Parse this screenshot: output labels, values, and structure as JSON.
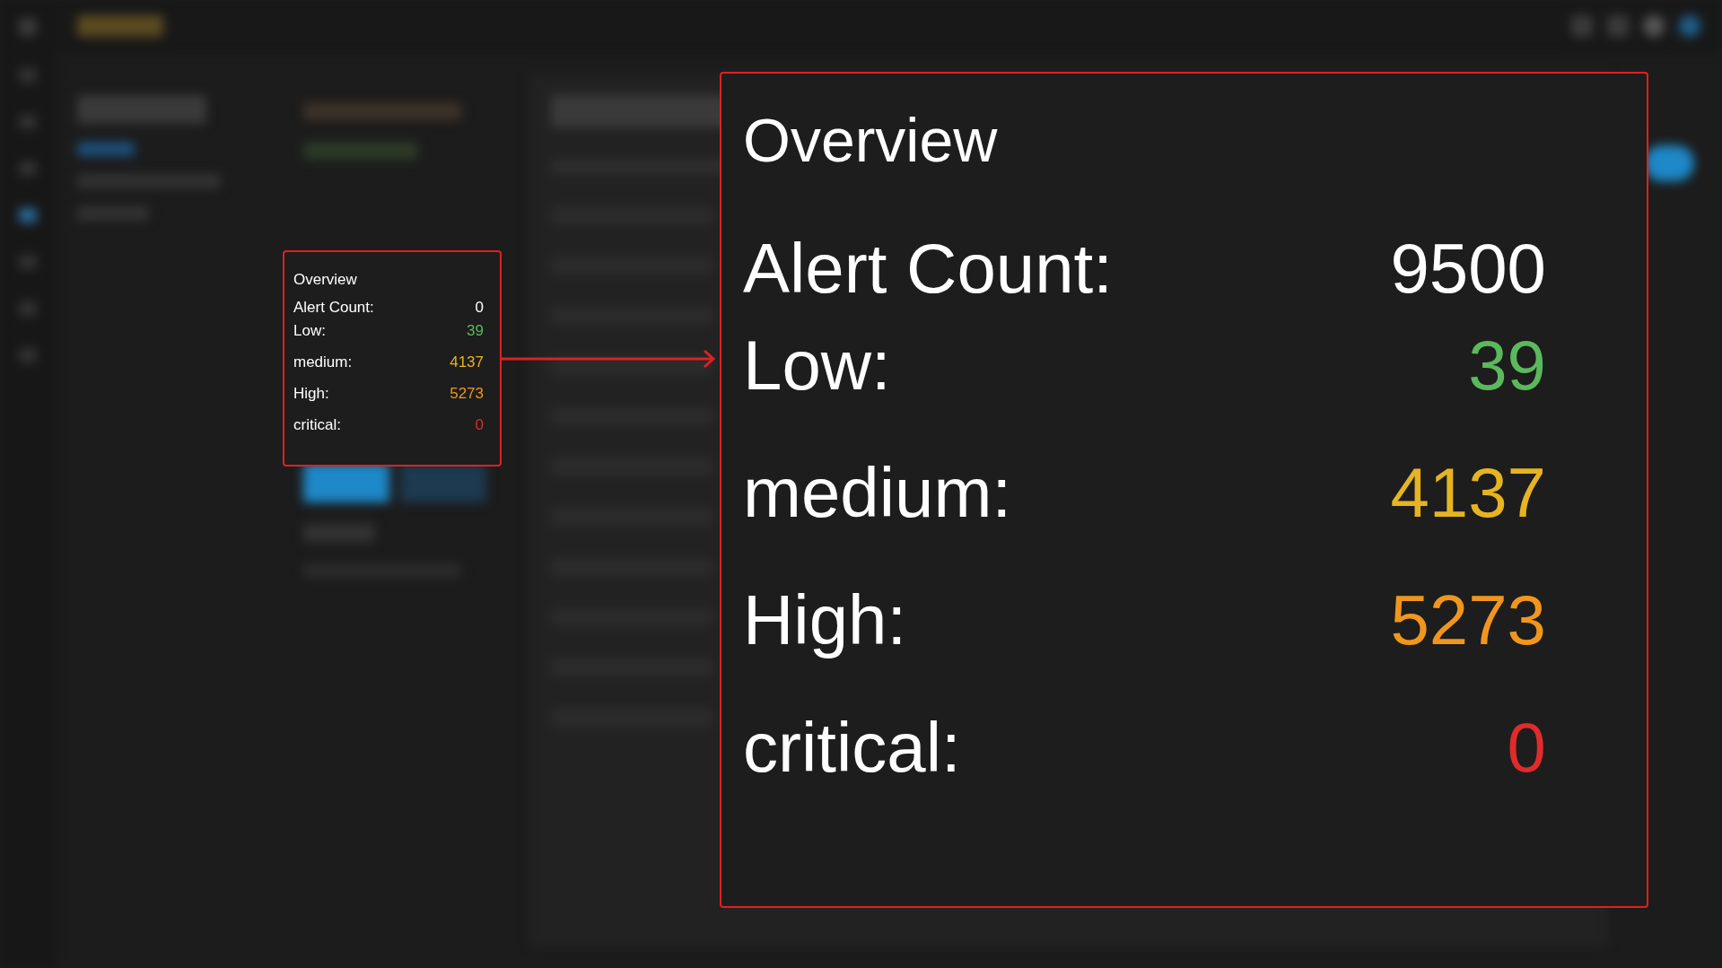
{
  "small_panel": {
    "title": "Overview",
    "rows": [
      {
        "label": "Alert Count:",
        "value": "0",
        "color": "#ffffff"
      },
      {
        "label": "Low:",
        "value": "39",
        "color": "#5cb85c"
      },
      {
        "label": "medium:",
        "value": "4137",
        "color": "#e6b422"
      },
      {
        "label": "High:",
        "value": "5273",
        "color": "#f0961e"
      },
      {
        "label": "critical:",
        "value": "0",
        "color": "#e02b2b"
      }
    ]
  },
  "zoomed_panel": {
    "title": "Overview",
    "rows": [
      {
        "label": "Alert Count:",
        "value": "9500",
        "color": "#ffffff"
      },
      {
        "label": "Low:",
        "value": "39",
        "color": "#5cb85c"
      },
      {
        "label": "medium:",
        "value": "4137",
        "color": "#e6b422"
      },
      {
        "label": "High:",
        "value": "5273",
        "color": "#f0961e"
      },
      {
        "label": "critical:",
        "value": "0",
        "color": "#e02b2b"
      }
    ]
  }
}
